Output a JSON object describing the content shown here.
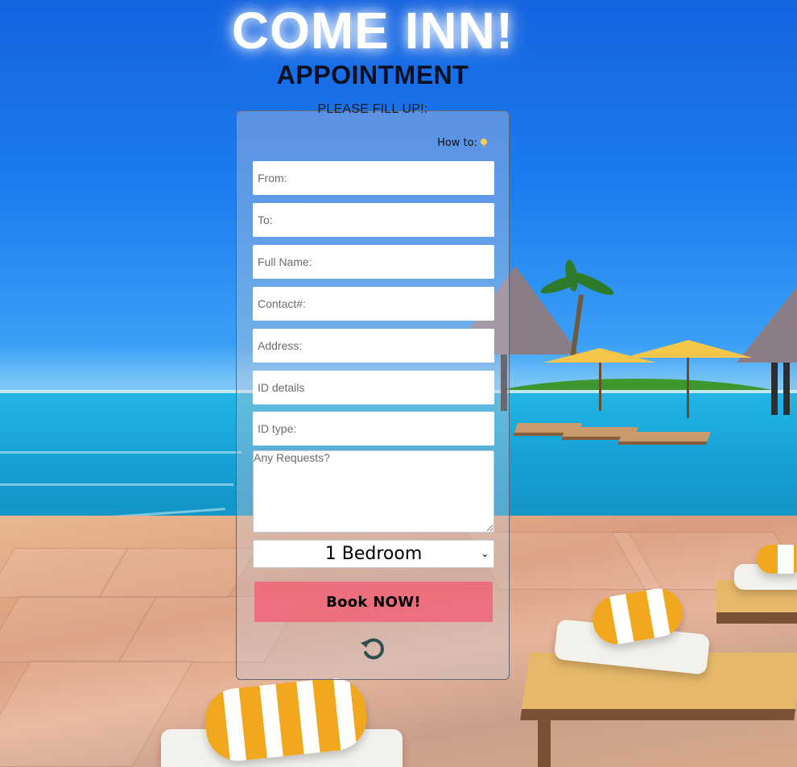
{
  "header": {
    "title": "COME INN!",
    "subtitle": "APPOINTMENT"
  },
  "form": {
    "legend": "PLEASE FILL UP!:",
    "howto_label": "How to:",
    "howto_icon": "lightbulb-icon",
    "fields": {
      "from": {
        "placeholder": "From:",
        "value": ""
      },
      "to": {
        "placeholder": "To:",
        "value": ""
      },
      "full_name": {
        "placeholder": "Full Name:",
        "value": ""
      },
      "contact": {
        "placeholder": "Contact#:",
        "value": ""
      },
      "address": {
        "placeholder": "Address:",
        "value": ""
      },
      "id_details": {
        "placeholder": "ID details",
        "value": ""
      },
      "id_type": {
        "placeholder": "ID type:",
        "value": ""
      },
      "requests": {
        "placeholder": "Any Requests?",
        "value": ""
      }
    },
    "room_select": {
      "selected": "1 Bedroom"
    },
    "book_button": "Book NOW!",
    "reset_icon": "reset-icon"
  },
  "colors": {
    "book_button": "#f06478",
    "reset_icon": "#2f4f4f",
    "title_glow": "#ffffff"
  }
}
